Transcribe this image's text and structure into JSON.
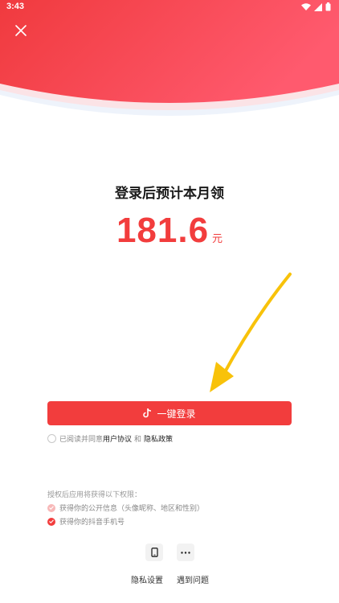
{
  "status_bar": {
    "time": "3:43",
    "icons": [
      "wifi-icon",
      "signal-icon",
      "battery-icon"
    ]
  },
  "header": {
    "close_icon": "close-icon",
    "accent_color": "#f23d3d"
  },
  "main": {
    "headline": "登录后预计本月领",
    "amount": "181.6",
    "unit": "元"
  },
  "login": {
    "button_label": "一键登录",
    "button_icon": "douyin-icon"
  },
  "agreement": {
    "prefix": "已阅读并同意",
    "user_agreement": "用户协议",
    "and": "和",
    "privacy_policy": "隐私政策"
  },
  "permissions": {
    "title": "授权后应用将获得以下权限：",
    "items": [
      {
        "label": "获得你的公开信息（头像昵称、地区和性别）",
        "checked": true
      },
      {
        "label": "获得你的抖音手机号",
        "checked": true
      }
    ]
  },
  "bottom": {
    "privacy_settings": "隐私设置",
    "problem": "遇到问题",
    "icons": [
      "phone-icon",
      "more-icon"
    ]
  }
}
